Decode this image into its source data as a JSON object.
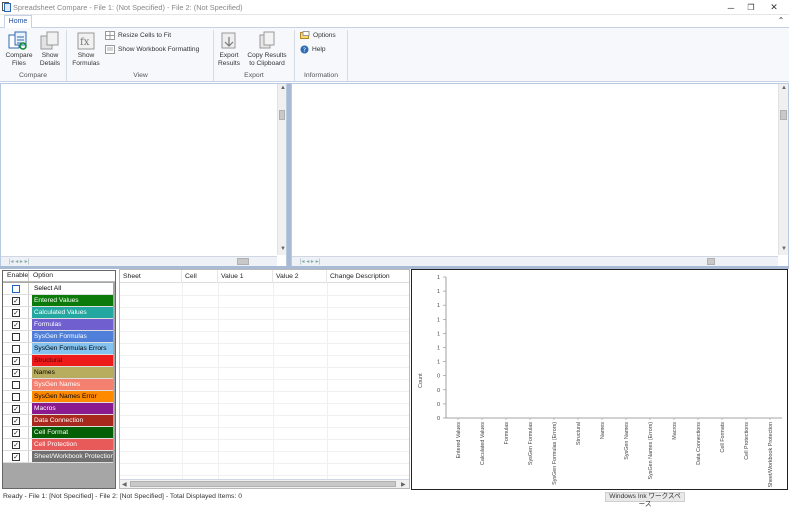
{
  "window": {
    "title": "Spreadsheet Compare - File 1: (Not Specified) - File 2: (Not Specified)",
    "minimize": "─",
    "maximize": "❐",
    "close": "✕"
  },
  "ribbon": {
    "tab": "Home",
    "collapse": "⌃",
    "compare_files": [
      "Compare",
      "Files"
    ],
    "show_details": [
      "Show",
      "Details"
    ],
    "show_formulas": [
      "Show",
      "Formulas"
    ],
    "resize_cells": "Resize Cells to Fit",
    "show_workbook_formatting": "Show Workbook Formatting",
    "export_results": [
      "Export",
      "Results"
    ],
    "copy_results": [
      "Copy Results",
      "to Clipboard"
    ],
    "options": "Options",
    "help": "Help",
    "groups": {
      "compare": "Compare",
      "view": "View",
      "export": "Export",
      "information": "Information"
    }
  },
  "options_panel": {
    "header_enable": "Enable",
    "header_option": "Option",
    "items": [
      {
        "label": "Select All",
        "checked": false,
        "color": "#ffffff",
        "text_color": "#000000"
      },
      {
        "label": "Entered Values",
        "checked": true,
        "color": "#0b7a0b",
        "text_color": "#ffffff"
      },
      {
        "label": "Calculated Values",
        "checked": true,
        "color": "#22a8a0",
        "text_color": "#ffffff"
      },
      {
        "label": "Formulas",
        "checked": true,
        "color": "#6f5fcf",
        "text_color": "#ffffff"
      },
      {
        "label": "SysGen Formulas",
        "checked": false,
        "color": "#4f7fd9",
        "text_color": "#ffffff"
      },
      {
        "label": "SysGen Formulas Errors",
        "checked": false,
        "color": "#84c3f0",
        "text_color": "#000000"
      },
      {
        "label": "Structural",
        "checked": true,
        "color": "#ee1b1b",
        "text_color": "#5a0000"
      },
      {
        "label": "Names",
        "checked": true,
        "color": "#b8ad5e",
        "text_color": "#000000"
      },
      {
        "label": "SysGen Names",
        "checked": false,
        "color": "#f48070",
        "text_color": "#ffffff"
      },
      {
        "label": "SysGen Names Error",
        "checked": false,
        "color": "#ff8a00",
        "text_color": "#000000"
      },
      {
        "label": "Macros",
        "checked": true,
        "color": "#8a1a8e",
        "text_color": "#ffffff"
      },
      {
        "label": "Data Connection",
        "checked": true,
        "color": "#a8281e",
        "text_color": "#ffffff"
      },
      {
        "label": "Cell Format",
        "checked": true,
        "color": "#056005",
        "text_color": "#ffffff"
      },
      {
        "label": "Cell Protection",
        "checked": true,
        "color": "#e85a5a",
        "text_color": "#ffffff"
      },
      {
        "label": "Sheet/Workbook Protection",
        "checked": true,
        "color": "#707070",
        "text_color": "#ffffff"
      }
    ]
  },
  "results_grid": {
    "columns": [
      "Sheet",
      "Cell",
      "Value 1",
      "Value 2",
      "Change Description"
    ]
  },
  "chart_data": {
    "type": "bar",
    "ylabel": "Count",
    "y_tick_labels": [
      "1",
      "1",
      "1",
      "1",
      "1",
      "1",
      "1",
      "0",
      "0",
      "0",
      "0"
    ],
    "categories": [
      "Entered Values",
      "Calculated Values",
      "Formulas",
      "SysGen Formulas",
      "SysGen Formulas (Errors)",
      "Structural",
      "Names",
      "SysGen Names",
      "SysGen Names (Errors)",
      "Macros",
      "Data Connections",
      "Cell Formats",
      "Cell Protections",
      "Sheet/Workbook Protection"
    ],
    "values": [
      0,
      0,
      0,
      0,
      0,
      0,
      0,
      0,
      0,
      0,
      0,
      0,
      0,
      0
    ]
  },
  "status": {
    "text": "Ready - File 1: [Not Specified] - File 2: [Not Specified] - Total Displayed Items: 0",
    "ink": "Windows Ink ワークスペース"
  }
}
